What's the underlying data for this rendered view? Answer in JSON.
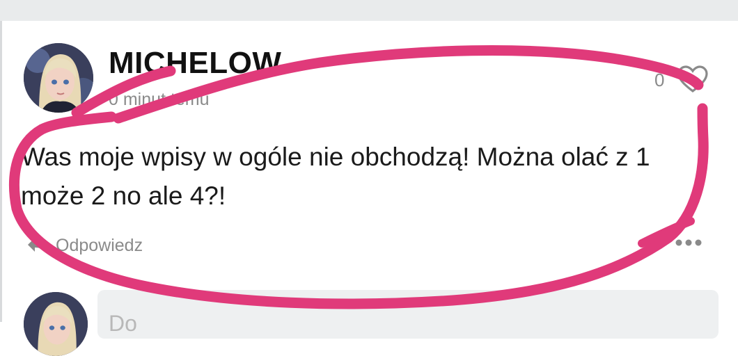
{
  "post": {
    "username": "MICHELOW",
    "time_ago": "0 minut temu",
    "like_count": "0",
    "message": "Was moje wpisy w ogóle nie obchodzą! Można olać z 1 może 2 no ale 4?!",
    "reply_label": "Odpowiedz"
  },
  "comment_box": {
    "placeholder": "Do"
  },
  "icons": {
    "like": "heart-icon",
    "reply": "reply-arrow-icon",
    "more": "more-options-icon"
  },
  "colors": {
    "highlight_scribble": "#e03a7a",
    "muted_text": "#8a8a8a",
    "top_bar": "#e9ebec",
    "input_bg": "#eef0f1"
  }
}
